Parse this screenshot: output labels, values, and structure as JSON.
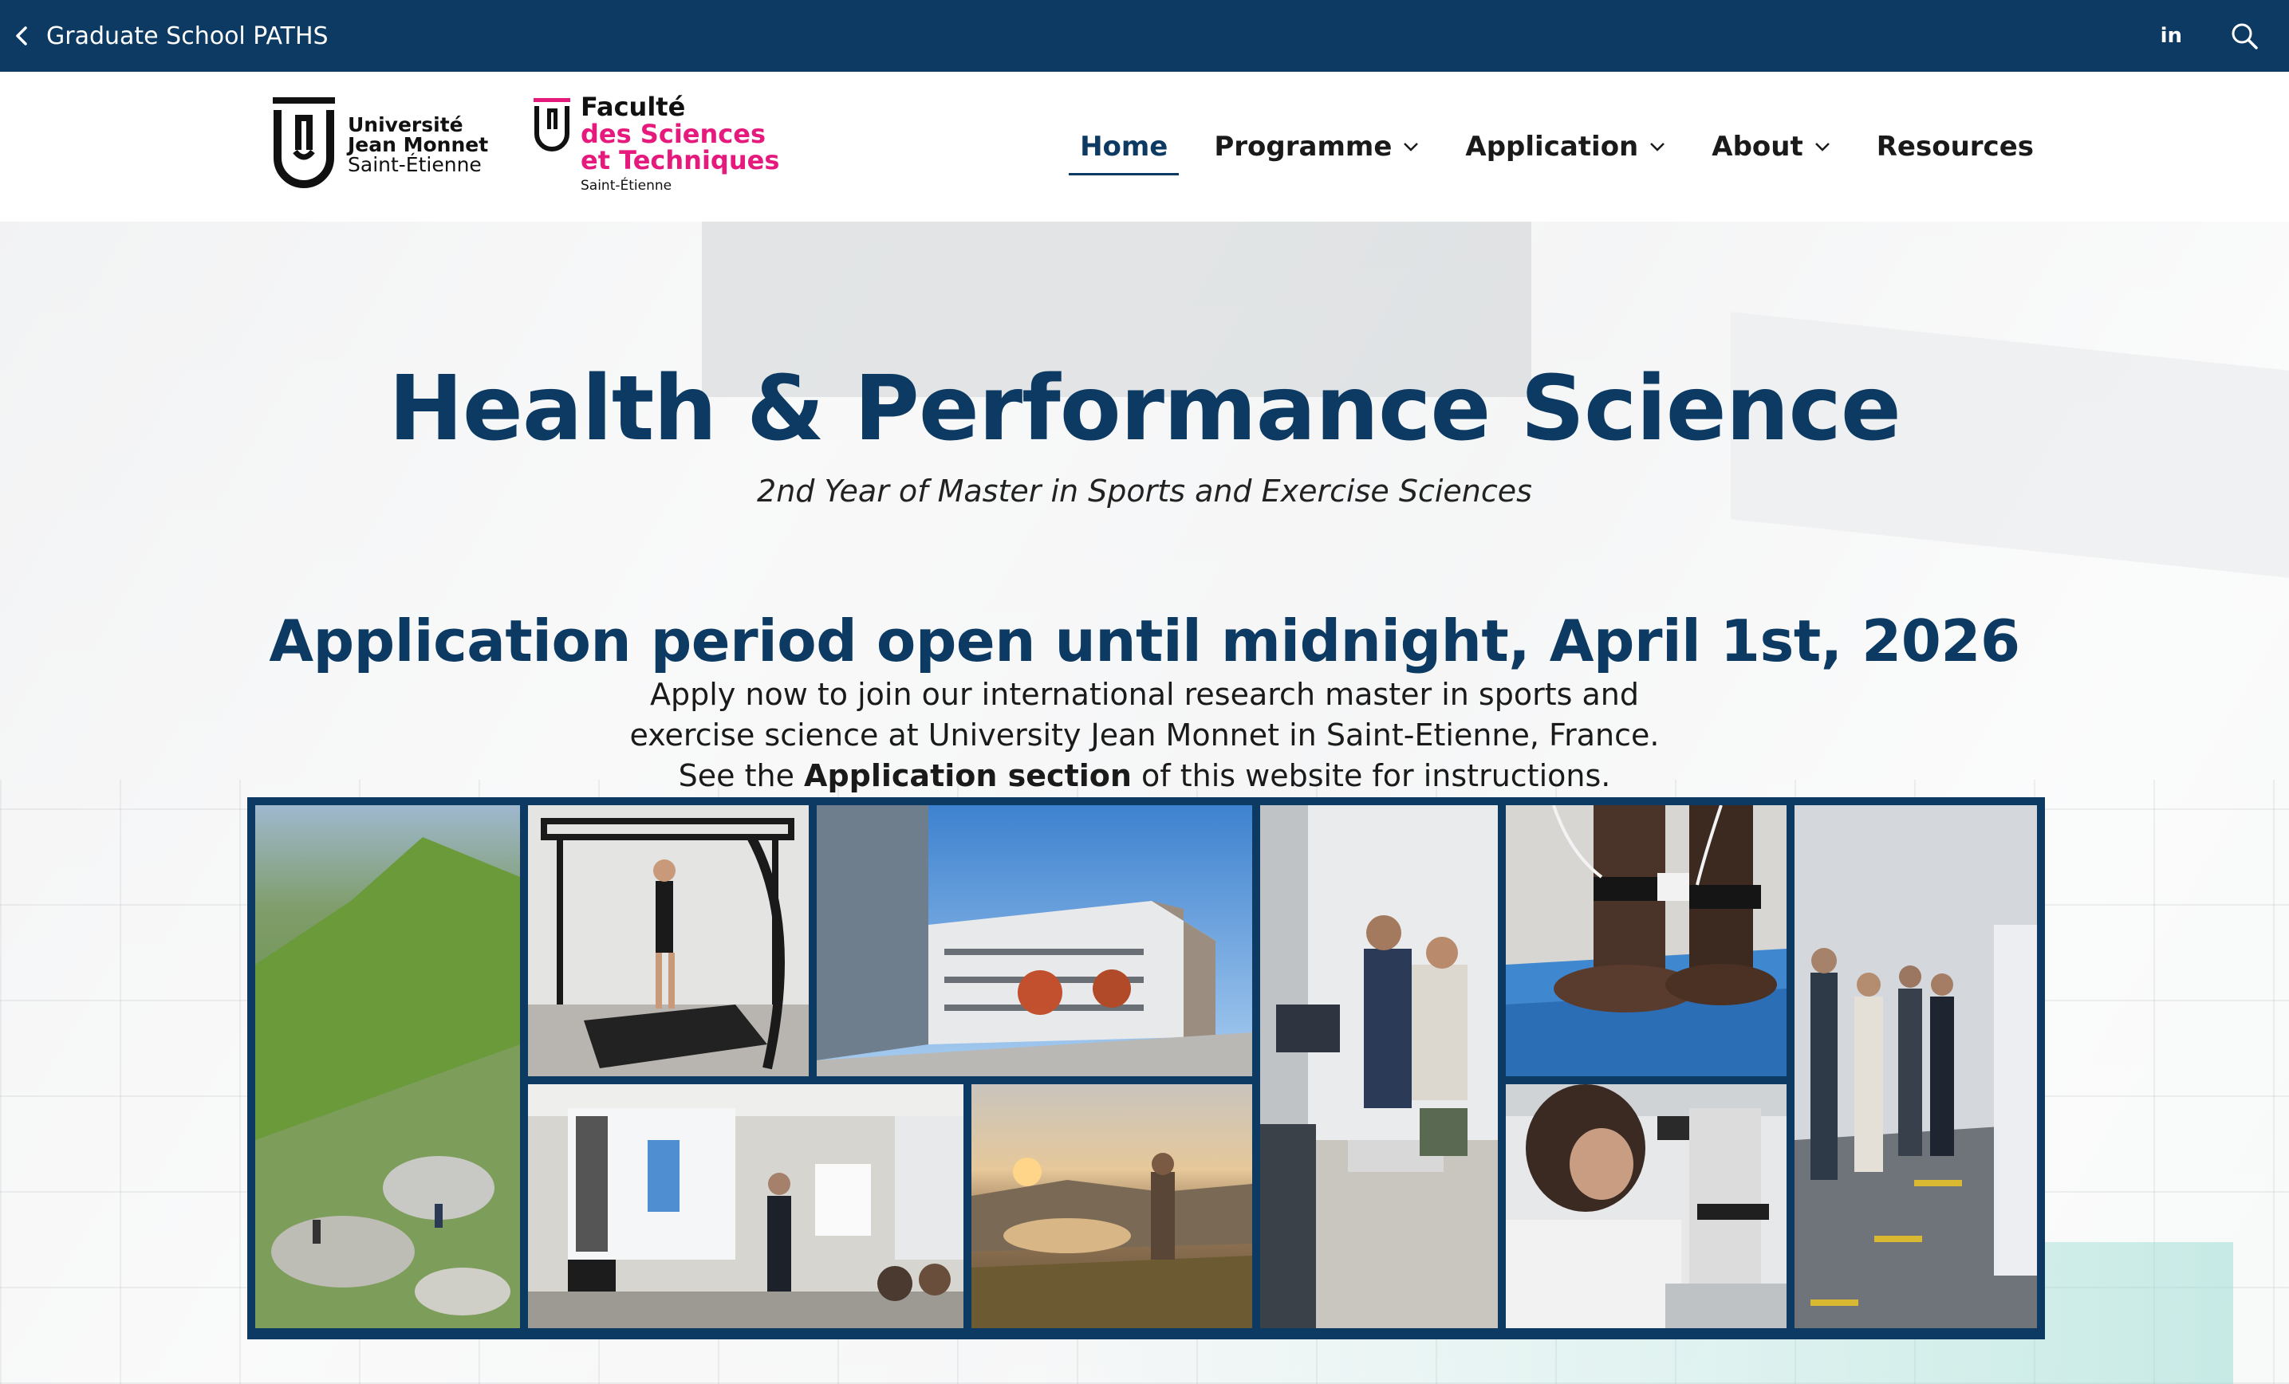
{
  "topbar": {
    "back_label": "Graduate School PATHS",
    "linkedin_label": "in"
  },
  "header": {
    "logo_ujm": {
      "line1": "Université",
      "line2": "Jean Monnet",
      "line3": "Saint-Étienne"
    },
    "logo_fst": {
      "line1": "Faculté",
      "line2": "des Sciences",
      "line3": "et Techniques",
      "line4": "Saint-Étienne"
    },
    "nav": [
      {
        "label": "Home",
        "active": true,
        "dropdown": false
      },
      {
        "label": "Programme",
        "active": false,
        "dropdown": true
      },
      {
        "label": "Application",
        "active": false,
        "dropdown": true
      },
      {
        "label": "About",
        "active": false,
        "dropdown": true
      },
      {
        "label": "Resources",
        "active": false,
        "dropdown": false
      }
    ]
  },
  "hero": {
    "title": "Health & Performance Science",
    "subtitle": "2nd Year of Master in Sports and Exercise Sciences",
    "deadline": "Application period open until midnight, April 1st, 2026",
    "text_line1": "Apply now to join our international research master in sports and",
    "text_line2": "exercise science at University Jean Monnet in Saint-Etienne, France.",
    "text_line3_pre": "See the ",
    "text_line3_bold": "Application section",
    "text_line3_post": " of this website for instructions."
  },
  "colors": {
    "brand_navy": "#0c3a63",
    "brand_pink": "#e6197d"
  }
}
